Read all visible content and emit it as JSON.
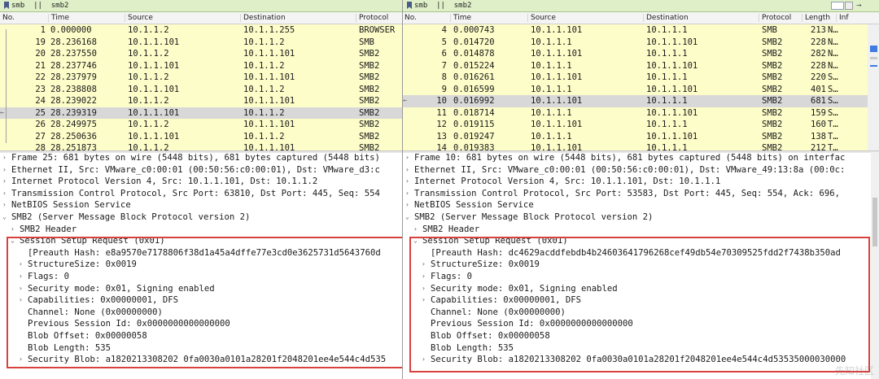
{
  "left": {
    "filter": "smb  ||  smb2",
    "columns": [
      "No.",
      "Time",
      "Source",
      "Destination",
      "Protocol"
    ],
    "packets": [
      {
        "no": "1",
        "time": "0.000000",
        "src": "10.1.1.2",
        "dst": "10.1.1.255",
        "proto": "BROWSER",
        "selected": false
      },
      {
        "no": "19",
        "time": "28.236168",
        "src": "10.1.1.101",
        "dst": "10.1.1.2",
        "proto": "SMB",
        "selected": false
      },
      {
        "no": "20",
        "time": "28.237550",
        "src": "10.1.1.2",
        "dst": "10.1.1.101",
        "proto": "SMB2",
        "selected": false
      },
      {
        "no": "21",
        "time": "28.237746",
        "src": "10.1.1.101",
        "dst": "10.1.1.2",
        "proto": "SMB2",
        "selected": false
      },
      {
        "no": "22",
        "time": "28.237979",
        "src": "10.1.1.2",
        "dst": "10.1.1.101",
        "proto": "SMB2",
        "selected": false
      },
      {
        "no": "23",
        "time": "28.238808",
        "src": "10.1.1.101",
        "dst": "10.1.1.2",
        "proto": "SMB2",
        "selected": false
      },
      {
        "no": "24",
        "time": "28.239022",
        "src": "10.1.1.2",
        "dst": "10.1.1.101",
        "proto": "SMB2",
        "selected": false
      },
      {
        "no": "25",
        "time": "28.239319",
        "src": "10.1.1.101",
        "dst": "10.1.1.2",
        "proto": "SMB2",
        "selected": true
      },
      {
        "no": "26",
        "time": "28.249975",
        "src": "10.1.1.2",
        "dst": "10.1.1.101",
        "proto": "SMB2",
        "selected": false
      },
      {
        "no": "27",
        "time": "28.250636",
        "src": "10.1.1.101",
        "dst": "10.1.1.2",
        "proto": "SMB2",
        "selected": false
      },
      {
        "no": "28",
        "time": "28.251873",
        "src": "10.1.1.2",
        "dst": "10.1.1.101",
        "proto": "SMB2",
        "selected": false
      }
    ],
    "details": [
      {
        "arrow": "›",
        "text": "Frame 25: 681 bytes on wire (5448 bits), 681 bytes captured (5448 bits)"
      },
      {
        "arrow": "›",
        "text": "Ethernet II, Src: VMware_c0:00:01 (00:50:56:c0:00:01), Dst: VMware_d3:c"
      },
      {
        "arrow": "›",
        "text": "Internet Protocol Version 4, Src: 10.1.1.101, Dst: 10.1.1.2"
      },
      {
        "arrow": "›",
        "text": "Transmission Control Protocol, Src Port: 63810, Dst Port: 445, Seq: 554"
      },
      {
        "arrow": "›",
        "text": "NetBIOS Session Service"
      },
      {
        "arrow": "⌄",
        "text": "SMB2 (Server Message Block Protocol version 2)"
      },
      {
        "arrow": "›",
        "text": "SMB2 Header"
      },
      {
        "arrow": "⌄",
        "text": "Session Setup Request (0x01)"
      },
      {
        "arrow": "",
        "text": "[Preauth Hash: e8a9570e7178806f38d1a45a4dffe77e3cd0e3625731d5643760d"
      },
      {
        "arrow": "›",
        "text": "StructureSize: 0x0019"
      },
      {
        "arrow": "›",
        "text": "Flags: 0"
      },
      {
        "arrow": "›",
        "text": "Security mode: 0x01, Signing enabled"
      },
      {
        "arrow": "›",
        "text": "Capabilities: 0x00000001, DFS"
      },
      {
        "arrow": "",
        "text": "Channel: None (0x00000000)"
      },
      {
        "arrow": "",
        "text": "Previous Session Id: 0x0000000000000000"
      },
      {
        "arrow": "",
        "text": "Blob Offset: 0x00000058"
      },
      {
        "arrow": "",
        "text": "Blob Length: 535"
      },
      {
        "arrow": "›",
        "text": "Security Blob: a1820213308202 0fa0030a0101a28201f2048201ee4e544c4d535"
      }
    ]
  },
  "right": {
    "filter": "smb  ||  smb2",
    "columns": [
      "No.",
      "Time",
      "Source",
      "Destination",
      "Protocol",
      "Length",
      "Inf"
    ],
    "packets": [
      {
        "no": "4",
        "time": "0.000743",
        "src": "10.1.1.101",
        "dst": "10.1.1.1",
        "proto": "SMB",
        "len": "213",
        "info": "N…",
        "selected": false
      },
      {
        "no": "5",
        "time": "0.014720",
        "src": "10.1.1.1",
        "dst": "10.1.1.101",
        "proto": "SMB2",
        "len": "228",
        "info": "N…",
        "selected": false
      },
      {
        "no": "6",
        "time": "0.014878",
        "src": "10.1.1.101",
        "dst": "10.1.1.1",
        "proto": "SMB2",
        "len": "282",
        "info": "N…",
        "selected": false
      },
      {
        "no": "7",
        "time": "0.015224",
        "src": "10.1.1.1",
        "dst": "10.1.1.101",
        "proto": "SMB2",
        "len": "228",
        "info": "N…",
        "selected": false
      },
      {
        "no": "8",
        "time": "0.016261",
        "src": "10.1.1.101",
        "dst": "10.1.1.1",
        "proto": "SMB2",
        "len": "220",
        "info": "S…",
        "selected": false
      },
      {
        "no": "9",
        "time": "0.016599",
        "src": "10.1.1.1",
        "dst": "10.1.1.101",
        "proto": "SMB2",
        "len": "401",
        "info": "S…",
        "selected": false
      },
      {
        "no": "10",
        "time": "0.016992",
        "src": "10.1.1.101",
        "dst": "10.1.1.1",
        "proto": "SMB2",
        "len": "681",
        "info": "S…",
        "selected": true
      },
      {
        "no": "11",
        "time": "0.018714",
        "src": "10.1.1.1",
        "dst": "10.1.1.101",
        "proto": "SMB2",
        "len": "159",
        "info": "S…",
        "selected": false
      },
      {
        "no": "12",
        "time": "0.019115",
        "src": "10.1.1.101",
        "dst": "10.1.1.1",
        "proto": "SMB2",
        "len": "160",
        "info": "T…",
        "selected": false
      },
      {
        "no": "13",
        "time": "0.019247",
        "src": "10.1.1.1",
        "dst": "10.1.1.101",
        "proto": "SMB2",
        "len": "138",
        "info": "T…",
        "selected": false
      },
      {
        "no": "14",
        "time": "0.019383",
        "src": "10.1.1.101",
        "dst": "10.1.1.1",
        "proto": "SMB2",
        "len": "212",
        "info": "T…",
        "selected": false
      }
    ],
    "details": [
      {
        "arrow": "›",
        "text": "Frame 10: 681 bytes on wire (5448 bits), 681 bytes captured (5448 bits) on interfac"
      },
      {
        "arrow": "›",
        "text": "Ethernet II, Src: VMware_c0:00:01 (00:50:56:c0:00:01), Dst: VMware_49:13:8a (00:0c:"
      },
      {
        "arrow": "›",
        "text": "Internet Protocol Version 4, Src: 10.1.1.101, Dst: 10.1.1.1"
      },
      {
        "arrow": "›",
        "text": "Transmission Control Protocol, Src Port: 53583, Dst Port: 445, Seq: 554, Ack: 696,"
      },
      {
        "arrow": "›",
        "text": "NetBIOS Session Service"
      },
      {
        "arrow": "⌄",
        "text": "SMB2 (Server Message Block Protocol version 2)"
      },
      {
        "arrow": "›",
        "text": "SMB2 Header"
      },
      {
        "arrow": "⌄",
        "text": "Session Setup Request (0x01)"
      },
      {
        "arrow": "",
        "text": "[Preauth Hash: dc4629acddfebdb4b24603641796268cef49db54e70309525fdd2f7438b350ad"
      },
      {
        "arrow": "›",
        "text": "StructureSize: 0x0019"
      },
      {
        "arrow": "›",
        "text": "Flags: 0"
      },
      {
        "arrow": "›",
        "text": "Security mode: 0x01, Signing enabled"
      },
      {
        "arrow": "›",
        "text": "Capabilities: 0x00000001, DFS"
      },
      {
        "arrow": "",
        "text": "Channel: None (0x00000000)"
      },
      {
        "arrow": "",
        "text": "Previous Session Id: 0x0000000000000000"
      },
      {
        "arrow": "",
        "text": "Blob Offset: 0x00000058"
      },
      {
        "arrow": "",
        "text": "Blob Length: 535"
      },
      {
        "arrow": "›",
        "text": "Security Blob: a1820213308202 0fa0030a0101a28201f2048201ee4e544c4d53535000030000"
      }
    ]
  },
  "watermark": "先知社区",
  "colors": {
    "row_bg": "#fdfdc9",
    "selected_bg": "#d8d8d8",
    "filter_bg": "#dff0c8",
    "highlight_box": "#d9413f"
  }
}
